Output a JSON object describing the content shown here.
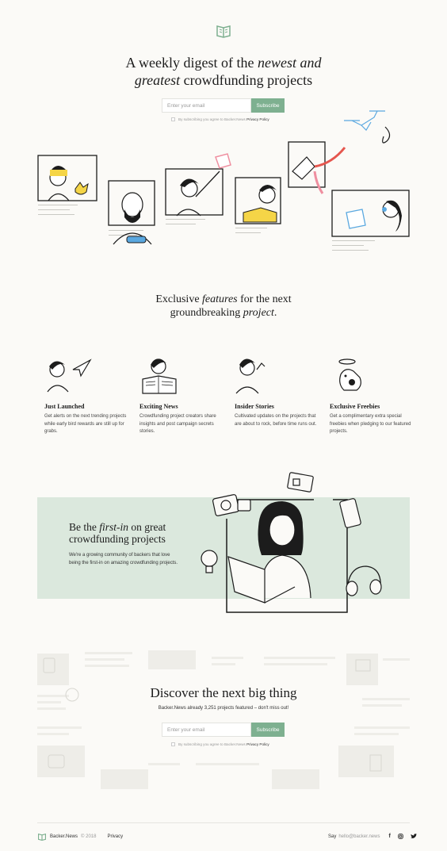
{
  "hero": {
    "title_pre": "A weekly digest of the ",
    "title_em1": "newest and",
    "title_em2": "greatest",
    "title_post": " crowdfunding projects",
    "email_placeholder": "Enter your email",
    "subscribe_label": "Subscribe",
    "consent_text": "By subscribing you agree to Backer.News",
    "consent_link": "Privacy Policy"
  },
  "features_section": {
    "title_pre": "Exclusive ",
    "title_em1": "features",
    "title_mid": " for the next",
    "title_line2": "groundbreaking ",
    "title_em2": "project",
    "title_end": ".",
    "items": [
      {
        "title": "Just Launched",
        "text": "Get alerts on the next trending projects while early bird rewards are still up for grabs."
      },
      {
        "title": "Exciting News",
        "text": "Crowdfunding project creators share insights and post campaign secrets stories."
      },
      {
        "title": "Insider Stories",
        "text": "Cultivated updates on the projects that are about to rock, before time runs out."
      },
      {
        "title": "Exclusive Freebies",
        "text": "Get a complimentary extra special freebies when pledging to our featured projects."
      }
    ]
  },
  "first_in": {
    "title_pre": "Be the ",
    "title_em": "first-in",
    "title_post": " on great",
    "title_line2": "crowdfunding projects",
    "text": "We're a growing community of backers that love being the first-in on amazing crowdfunding projects."
  },
  "discover": {
    "title": "Discover the next big thing",
    "subtitle": "Backer.News already 3,251 projects featured – don't miss out!",
    "email_placeholder": "Enter your email",
    "subscribe_label": "Subscribe",
    "consent_text": "By subscribing you agree to Backer.News",
    "consent_link": "Privacy Policy"
  },
  "footer": {
    "brand": "Backer.News",
    "copyright": "© 2018",
    "privacy": "Privacy",
    "say": "Say",
    "email": "hello@backer.news"
  },
  "colors": {
    "accent": "#7eb090",
    "panel": "#dbe8dd",
    "ink": "#1c1c1c",
    "yellow": "#f5d547",
    "blue": "#5aa8e0",
    "pink": "#ef8fa0",
    "red": "#e5564e"
  },
  "icons": [
    "book-logo-icon",
    "facebook-icon",
    "instagram-icon",
    "twitter-icon"
  ]
}
